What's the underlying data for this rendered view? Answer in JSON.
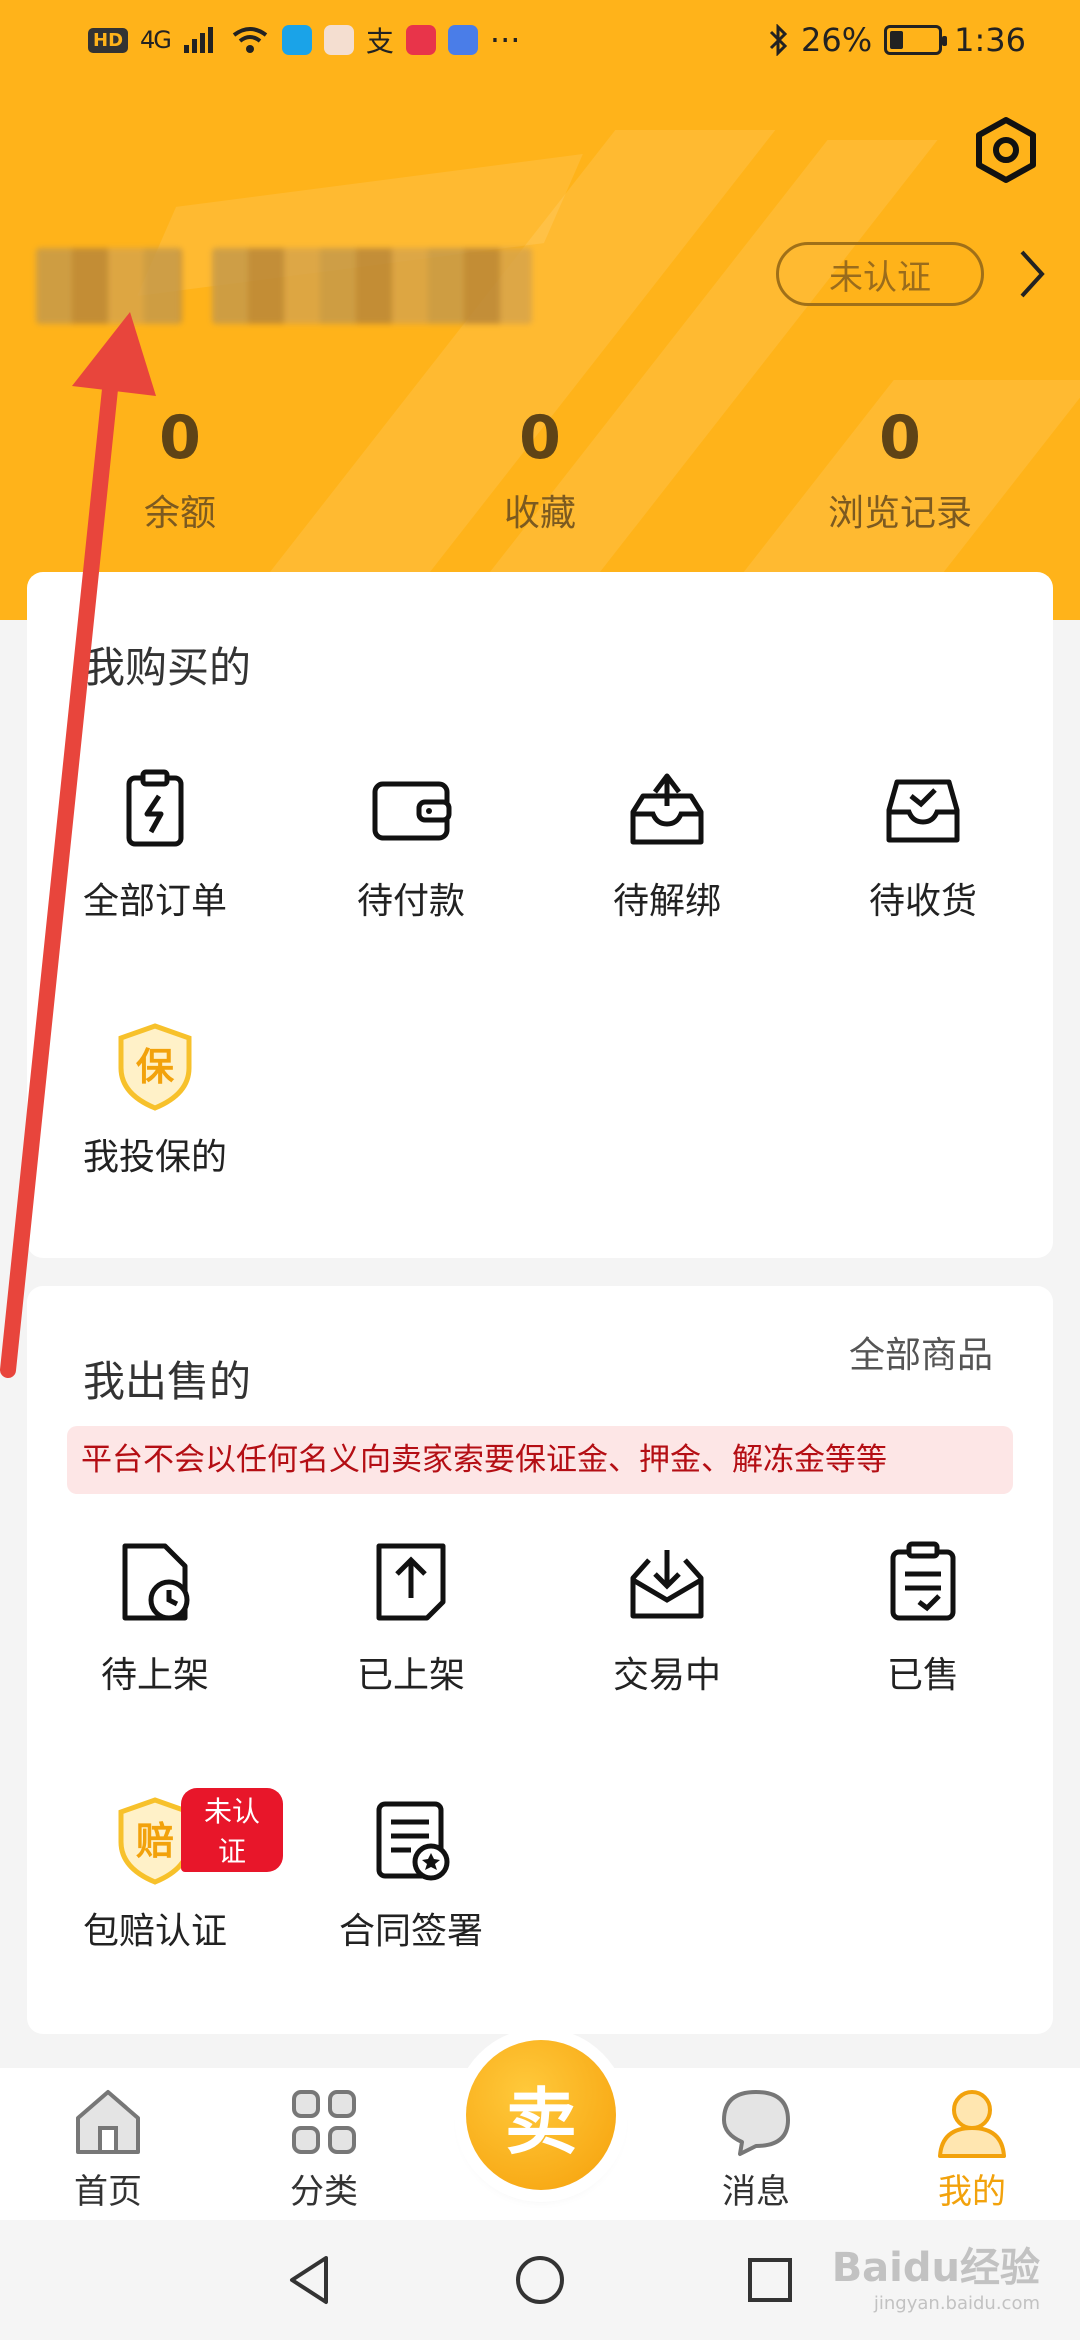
{
  "status_bar": {
    "hd": "HD",
    "signal": "4G",
    "battery": "26%",
    "time": "1:36",
    "more": "···"
  },
  "profile": {
    "verify_label": "未认证"
  },
  "stats": [
    {
      "value": "0",
      "label": "余额"
    },
    {
      "value": "0",
      "label": "收藏"
    },
    {
      "value": "0",
      "label": "浏览记录"
    }
  ],
  "buy_section": {
    "title": "我购买的",
    "items": [
      {
        "label": "全部订单",
        "icon": "clipboard-bolt-icon"
      },
      {
        "label": "待付款",
        "icon": "wallet-icon"
      },
      {
        "label": "待解绑",
        "icon": "inbox-up-icon"
      },
      {
        "label": "待收货",
        "icon": "inbox-check-icon"
      },
      {
        "label": "我投保的",
        "icon": "shield-bao-icon"
      }
    ]
  },
  "sell_section": {
    "title": "我出售的",
    "all_link": "全部商品",
    "notice": "平台不会以任何名义向卖家索要保证金、押金、解冻金等等",
    "items": [
      {
        "label": "待上架",
        "icon": "doc-clock-icon"
      },
      {
        "label": "已上架",
        "icon": "doc-upload-icon"
      },
      {
        "label": "交易中",
        "icon": "inbox-download-icon"
      },
      {
        "label": "已售",
        "icon": "clipboard-check-icon"
      },
      {
        "label": "包赔认证",
        "icon": "shield-pei-icon",
        "badge": "未认证"
      },
      {
        "label": "合同签署",
        "icon": "contract-icon"
      }
    ]
  },
  "bottom_nav": {
    "home": "首页",
    "category": "分类",
    "sell": "卖",
    "messages": "消息",
    "mine": "我的"
  },
  "colors": {
    "brand": "#ffb31a",
    "accent": "#f2a20c",
    "notice_bg": "#fde6e6",
    "notice_text": "#b40e14",
    "badge": "#e8162a"
  },
  "watermark": {
    "main": "Baidu经验",
    "sub": "jingyan.baidu.com"
  }
}
